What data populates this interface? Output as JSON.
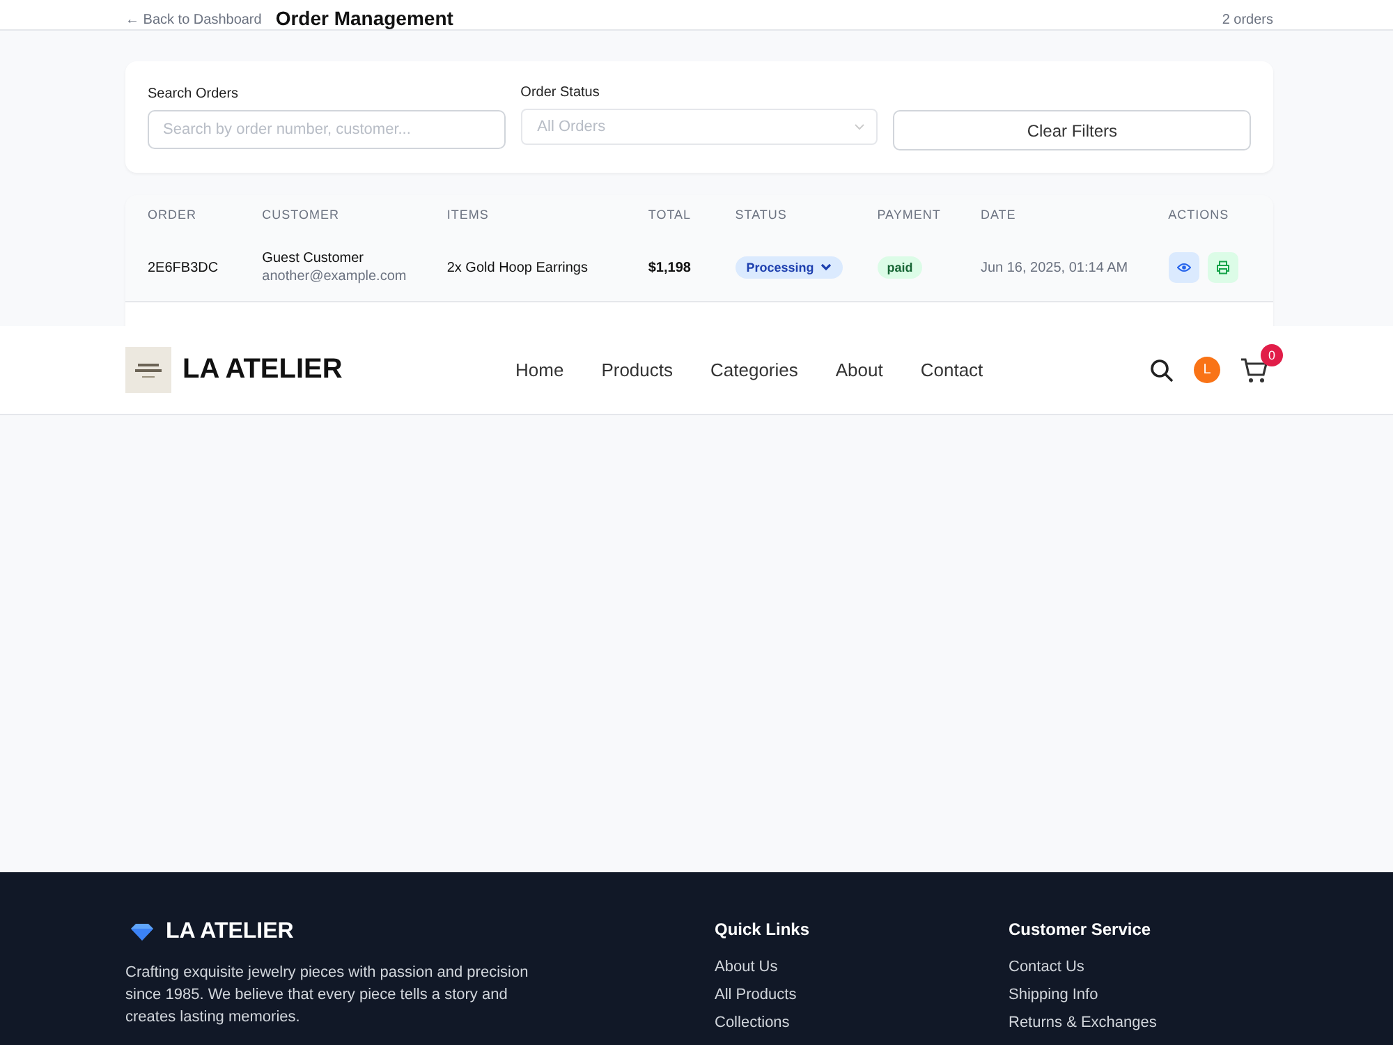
{
  "page_header": {
    "back_link": "← Back to Dashboard",
    "title": "Order Management",
    "count": "2 orders"
  },
  "filters": {
    "search": {
      "label": "Search Orders",
      "placeholder": "Search by order number, customer..."
    },
    "status": {
      "label": "Order Status",
      "placeholder": "All Orders"
    },
    "clear_button": "Clear Filters"
  },
  "table": {
    "columns": [
      "ORDER",
      "CUSTOMER",
      "ITEMS",
      "TOTAL",
      "STATUS",
      "PAYMENT",
      "DATE",
      "ACTIONS"
    ],
    "rows": [
      {
        "order": "2E6FB3DC",
        "customer": "Guest Customer",
        "email": "another@example.com",
        "items": "2x Gold Hoop Earrings",
        "total": "$1,198",
        "status": "Processing",
        "payment": "paid",
        "date": "Jun 16, 2025, 01:14 AM"
      }
    ]
  },
  "navbar": {
    "brand": "LA ATELIER",
    "links": [
      "Home",
      "Products",
      "Categories",
      "About",
      "Contact"
    ],
    "avatar": "L",
    "cart_count": "0"
  },
  "footer": {
    "brand": "LA ATELIER",
    "description": "Crafting exquisite jewelry pieces with passion and precision since 1985. We believe that every piece tells a story and creates lasting memories.",
    "columns": [
      {
        "title": "Quick Links",
        "links": [
          "About Us",
          "All Products",
          "Collections"
        ]
      },
      {
        "title": "Customer Service",
        "links": [
          "Contact Us",
          "Shipping Info",
          "Returns & Exchanges"
        ]
      }
    ]
  }
}
